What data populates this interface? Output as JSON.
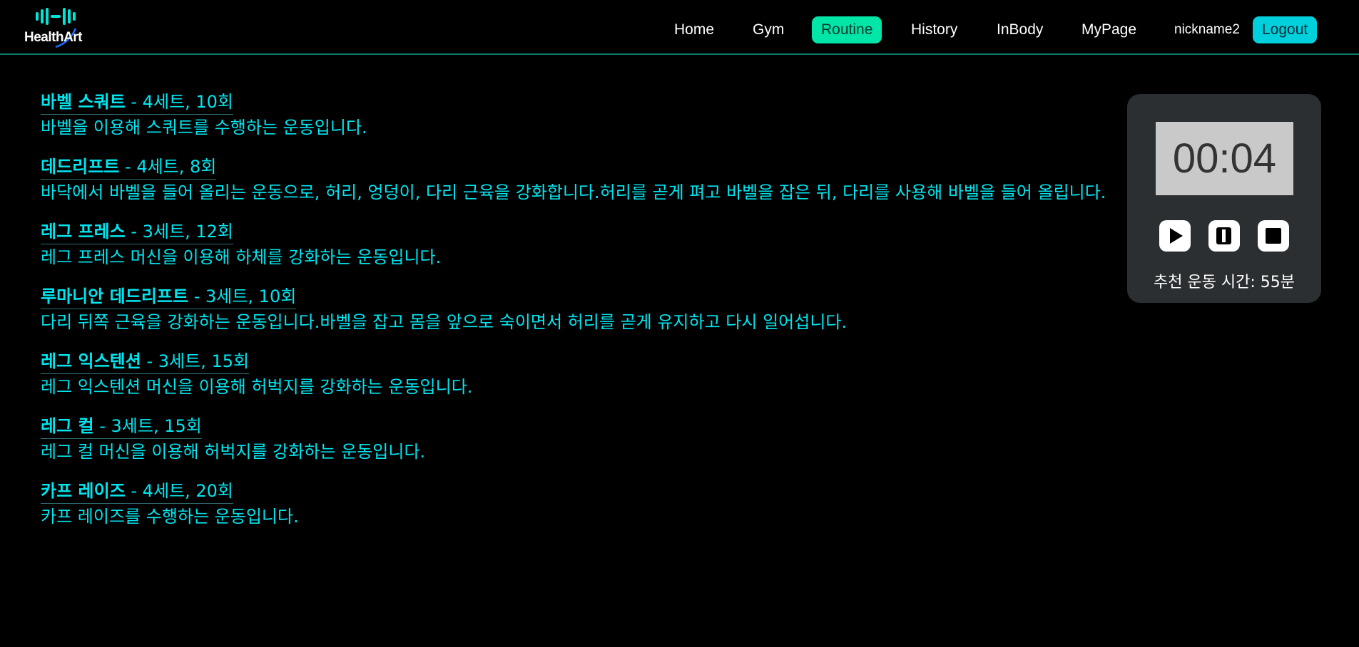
{
  "brand": {
    "name": "HealthArt",
    "accent": "#00e5d8"
  },
  "nav": {
    "items": [
      {
        "label": "Home"
      },
      {
        "label": "Gym"
      },
      {
        "label": "Routine",
        "active": true
      },
      {
        "label": "History"
      },
      {
        "label": "InBody"
      },
      {
        "label": "MyPage"
      }
    ],
    "nickname": "nickname2",
    "logout_label": "Logout"
  },
  "routine": {
    "exercises": [
      {
        "name": "바벨 스쿼트",
        "detail": " - 4세트, 10회",
        "description": "바벨을 이용해 스쿼트를 수행하는 운동입니다."
      },
      {
        "name": "데드리프트",
        "detail": " - 4세트, 8회",
        "description": "바닥에서 바벨을 들어 올리는 운동으로, 허리, 엉덩이, 다리 근육을 강화합니다.허리를 곧게 펴고 바벨을 잡은 뒤, 다리를 사용해 바벨을 들어 올립니다."
      },
      {
        "name": "레그 프레스",
        "detail": " - 3세트, 12회",
        "description": "레그 프레스 머신을 이용해 하체를 강화하는 운동입니다."
      },
      {
        "name": "루마니안 데드리프트",
        "detail": " - 3세트, 10회",
        "description": "다리 뒤쪽 근육을 강화하는 운동입니다.바벨을 잡고 몸을 앞으로 숙이면서 허리를 곧게 유지하고 다시 일어섭니다."
      },
      {
        "name": "레그 익스텐션",
        "detail": " - 3세트, 15회",
        "description": "레그 익스텐션 머신을 이용해 허벅지를 강화하는 운동입니다."
      },
      {
        "name": "레그 컬",
        "detail": " - 3세트, 15회",
        "description": "레그 컬 머신을 이용해 허벅지를 강화하는 운동입니다."
      },
      {
        "name": "카프 레이즈",
        "detail": " - 4세트, 20회",
        "description": "카프 레이즈를 수행하는 운동입니다."
      }
    ]
  },
  "timer": {
    "display": "00:04",
    "play_icon": "play-icon",
    "pause_icon": "pause-icon",
    "stop_icon": "stop-icon",
    "recommended": "추천 운동 시간: 55분"
  },
  "colors": {
    "background": "#000000",
    "text_accent": "#00e6f0",
    "active_nav": "#00e6a8",
    "logout": "#00d0dc",
    "timer_card": "#2b2f31"
  }
}
